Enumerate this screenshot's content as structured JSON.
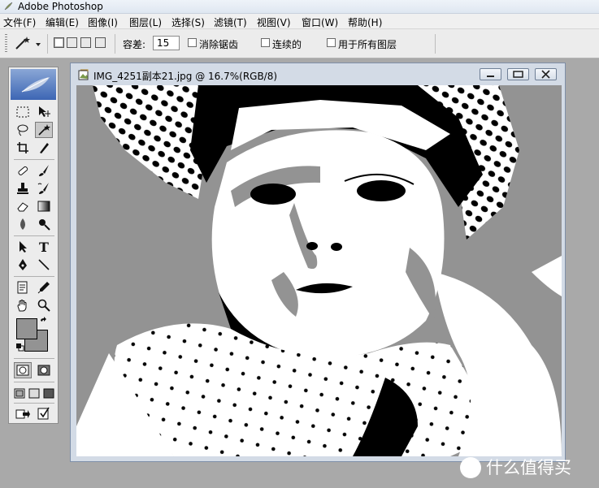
{
  "app": {
    "title": "Adobe Photoshop"
  },
  "menu": [
    "文件(F)",
    "编辑(E)",
    "图像(I)",
    "图层(L)",
    "选择(S)",
    "滤镜(T)",
    "视图(V)",
    "窗口(W)",
    "帮助(H)"
  ],
  "options": {
    "tolerance_label": "容差:",
    "tolerance_value": "15",
    "antialias_label": "消除锯齿",
    "contiguous_label": "连续的",
    "all_layers_label": "用于所有图层"
  },
  "document": {
    "title": "IMG_4251副本21.jpg @ 16.7%(RGB/8)"
  },
  "watermark": {
    "text": "什么值得买"
  },
  "colors": {
    "foreground": "#939393",
    "background": "#939393",
    "canvas_gray": "#939393"
  }
}
